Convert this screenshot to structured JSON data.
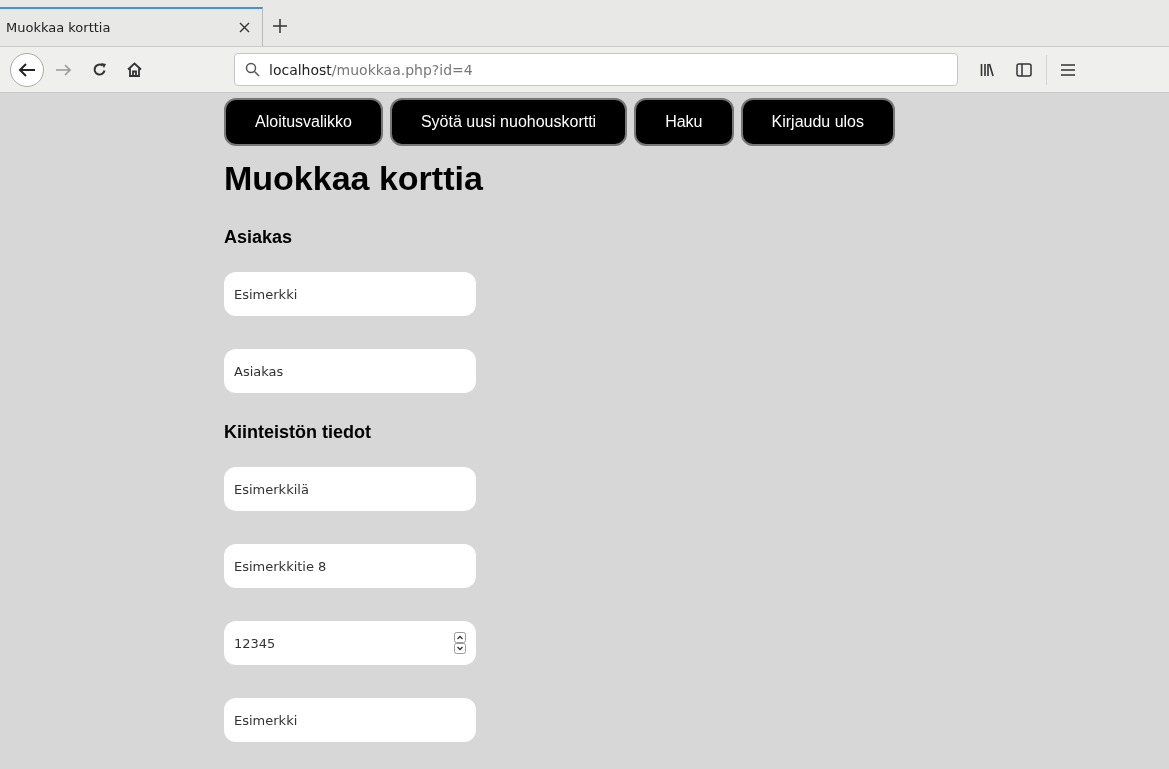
{
  "browser": {
    "tab_title": "Muokkaa korttia",
    "url_host": "localhost",
    "url_path": "/muokkaa.php?id=4"
  },
  "nav": [
    "Aloitusvalikko",
    "Syötä uusi nuohouskortti",
    "Haku",
    "Kirjaudu ulos"
  ],
  "heading": "Muokkaa korttia",
  "sections": [
    {
      "title": "Asiakas",
      "fields": [
        {
          "kind": "text",
          "value": "Esimerkki"
        },
        {
          "kind": "text",
          "value": "Asiakas"
        }
      ]
    },
    {
      "title": "Kiinteistön tiedot",
      "fields": [
        {
          "kind": "text",
          "value": "Esimerkkilä"
        },
        {
          "kind": "text",
          "value": "Esimerkkitie 8"
        },
        {
          "kind": "number",
          "value": "12345"
        },
        {
          "kind": "text",
          "value": "Esimerkki"
        }
      ]
    }
  ]
}
